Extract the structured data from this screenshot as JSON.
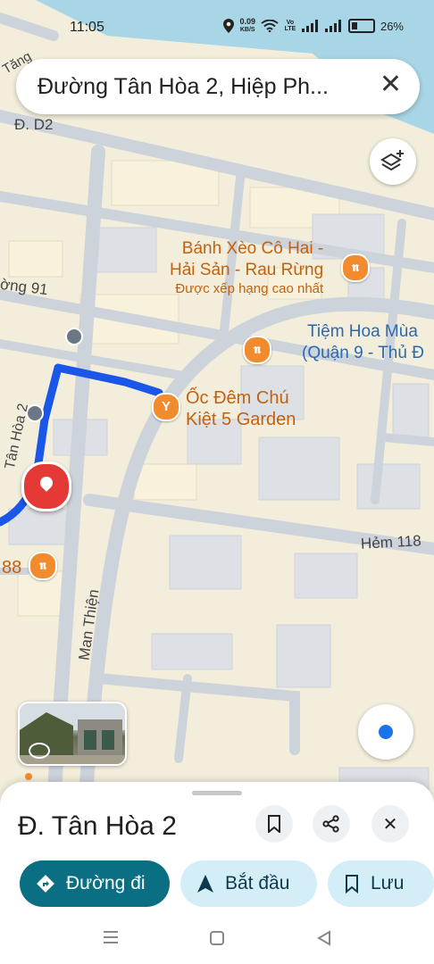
{
  "status_bar": {
    "time": "11:05",
    "net_speed_value": "0.09",
    "net_speed_unit": "KB/S",
    "volte_label": "Vo LTE",
    "battery_percent": "26%"
  },
  "search": {
    "query": "Đường Tân Hòa 2, Hiệp Ph..."
  },
  "map": {
    "street_labels": {
      "tang": "Tăng",
      "d2": "Đ. D2",
      "ong91": "ờng 91",
      "tanhoa2": "Tân Hòa 2",
      "man_thien": "Man Thiện",
      "hem118": "Hẻm 118"
    },
    "poi_banh_xeo": {
      "line1": "Bánh Xèo Cô Hai -",
      "line2": "Hải Sản - Rau Rừng",
      "subtitle": "Được xếp hạng cao nhất"
    },
    "poi_tiem_hoa": {
      "line1": "Tiệm Hoa Mùa",
      "line2": "(Quận 9 - Thủ Đ"
    },
    "poi_oc_dem": {
      "line1": "Ốc Đêm Chú",
      "line2": "Kiệt 5 Garden"
    },
    "poi_88": "88"
  },
  "sheet": {
    "title": "Đ. Tân Hòa 2",
    "directions_label": "Đường đi",
    "start_label": "Bắt đầu",
    "save_label": "Lưu"
  },
  "colors": {
    "route": "#1a56e8",
    "primary_button": "#0b6f84",
    "secondary_button": "#d4eef8",
    "poi_orange": "#f28b2e",
    "pin_red": "#e53935"
  },
  "icons": {
    "location": "location-icon",
    "wifi": "wifi-icon",
    "signal": "signal-icon",
    "battery": "battery-icon",
    "close": "close-icon",
    "layers": "layers-icon",
    "restaurant": "fork-knife-icon",
    "bar": "cocktail-icon",
    "bus": "bus-icon",
    "red_pin": "map-pin-icon",
    "streetview": "street-view-icon",
    "my_location": "my-location-icon",
    "bookmark": "bookmark-icon",
    "share": "share-icon",
    "directions": "directions-icon",
    "navigation": "navigation-arrow-icon"
  }
}
